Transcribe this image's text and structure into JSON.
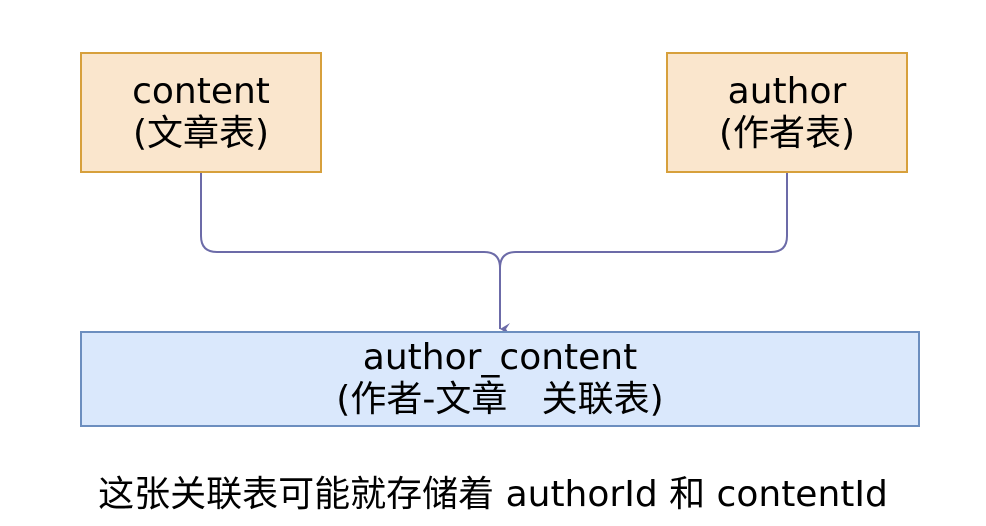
{
  "nodes": {
    "content": {
      "name": "content",
      "subtitle": "(文章表)"
    },
    "author": {
      "name": "author",
      "subtitle": "(作者表)"
    },
    "author_content": {
      "name": "author_content",
      "subtitle": "(作者-文章   关联表)"
    }
  },
  "caption": "这张关联表可能就存储着 authorId 和 contentId",
  "colors": {
    "table_fill": "#fae6cd",
    "table_border": "#d7a03c",
    "join_fill": "#dae8fc",
    "join_border": "#6c8ebf",
    "connector": "#6c6ba8"
  }
}
